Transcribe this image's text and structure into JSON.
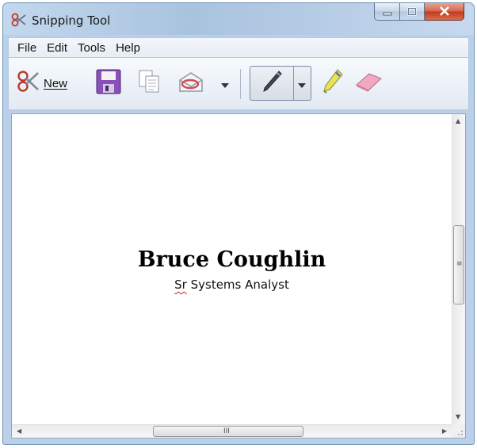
{
  "window": {
    "title": "Snipping Tool"
  },
  "menubar": {
    "items": [
      "File",
      "Edit",
      "Tools",
      "Help"
    ]
  },
  "toolbar": {
    "new_label": "New",
    "buttons": [
      "new-snip",
      "save-snip",
      "copy",
      "send-snip",
      "send-dropdown",
      "pen",
      "pen-dropdown",
      "highlighter",
      "eraser"
    ]
  },
  "document": {
    "name": "Bruce Coughlin",
    "title_word1": "Sr",
    "title_rest": " Systems Analyst"
  },
  "scrollbar": {
    "h_grip": "III",
    "v_grip": "≡"
  },
  "colors": {
    "accent": "#b9d0ea",
    "close": "#c1391c"
  }
}
